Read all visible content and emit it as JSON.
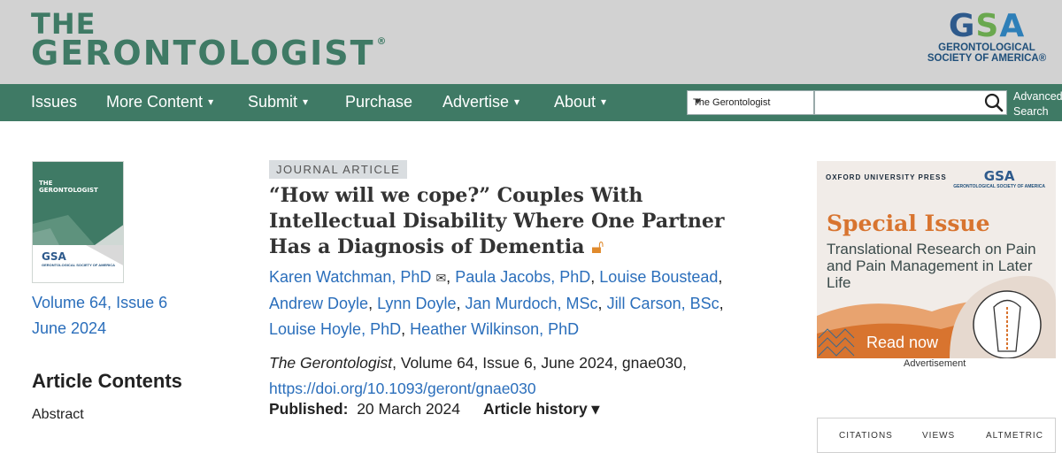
{
  "header": {
    "journal_line1": "THE",
    "journal_line2": "GERONTOLOGIST",
    "registered": "®",
    "publisher_mark": "GSA",
    "publisher_name_1": "GERONTOLOGICAL",
    "publisher_name_2": "SOCIETY OF AMERICA",
    "publisher_registered": "®"
  },
  "nav": {
    "items": [
      {
        "label": "Issues",
        "dropdown": false
      },
      {
        "label": "More Content",
        "dropdown": true
      },
      {
        "label": "Submit",
        "dropdown": true
      },
      {
        "label": "Purchase",
        "dropdown": false
      },
      {
        "label": "Advertise",
        "dropdown": true
      },
      {
        "label": "About",
        "dropdown": true
      }
    ],
    "caret": "▾",
    "search_scope": "The Gerontologist",
    "search_value": "",
    "advanced_search_1": "Advanced",
    "advanced_search_2": "Search"
  },
  "issue": {
    "cover_title_1": "THE",
    "cover_title_2": "GERONTOLOGIST",
    "cover_publisher": "GSA",
    "cover_publisher_sub": "GERONTOLOGICAL SOCIETY OF AMERICA",
    "volume_issue": "Volume 64, Issue 6",
    "date": "June 2024"
  },
  "contents": {
    "heading": "Article Contents",
    "items": [
      "Abstract"
    ]
  },
  "article": {
    "type": "JOURNAL ARTICLE",
    "title": "“How will we cope?” Couples With Intellectual Disability Where One Partner Has a Diagnosis of Dementia",
    "open_access_icon": "open-access-lock-icon",
    "authors": [
      "Karen Watchman, PhD",
      "Paula Jacobs, PhD",
      "Louise Boustead",
      "Andrew Doyle",
      "Lynn Doyle",
      "Jan Murdoch, MSc",
      "Jill Carson, BSc",
      "Louise Hoyle, PhD",
      "Heather Wilkinson, PhD"
    ],
    "journal_italic": "The Gerontologist",
    "citation_rest": ", Volume 64, Issue 6, June 2024, gnae030,",
    "doi": "https://doi.org/10.1093/geront/gnae030",
    "published_label": "Published:",
    "published_date": "20 March 2024",
    "history_label": "Article history ▾"
  },
  "ad": {
    "oxford": "OXFORD UNIVERSITY PRESS",
    "gsa": "GSA",
    "gsa_sub": "GERONTOLOGICAL SOCIETY OF AMERICA",
    "title": "Special Issue",
    "subtitle": "Translational Research on Pain and Pain Management in Later Life",
    "cta": "Read now",
    "label": "Advertisement"
  },
  "metrics": {
    "citations": "CITATIONS",
    "views": "VIEWS",
    "altmetric": "ALTMETRIC"
  },
  "colors": {
    "brand_green": "#3f7a65",
    "link_blue": "#2a6ebb",
    "ad_orange": "#d8742f"
  }
}
